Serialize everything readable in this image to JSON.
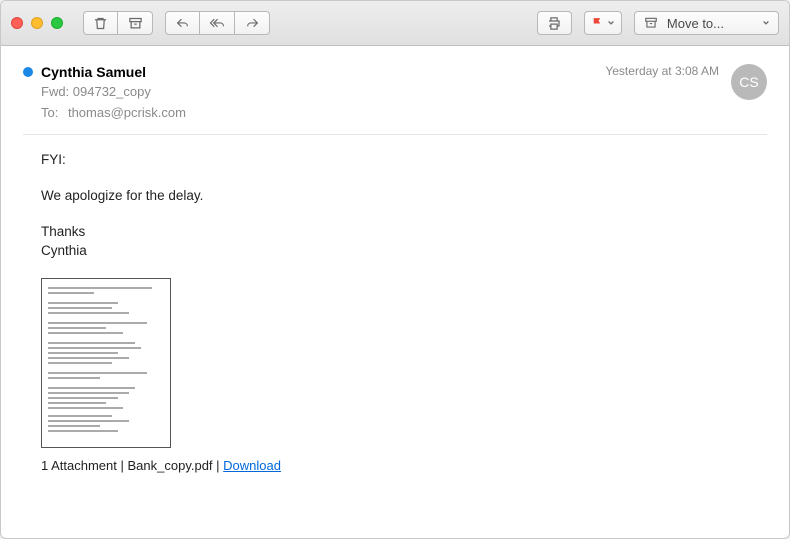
{
  "toolbar": {
    "move_to_label": "Move to..."
  },
  "email": {
    "sender": "Cynthia Samuel",
    "timestamp": "Yesterday at 3:08 AM",
    "avatar_initials": "CS",
    "subject": "Fwd: 094732_copy",
    "to_label": "To:",
    "to_value": "thomas@pcrisk.com",
    "body": {
      "line1": "FYI:",
      "line2": "We apologize for the delay.",
      "signoff1": "Thanks",
      "signoff2": "Cynthia"
    }
  },
  "attachment": {
    "count_label": "1 Attachment",
    "separator": " | ",
    "filename": "Bank_copy.pdf",
    "download_label": "Download"
  }
}
